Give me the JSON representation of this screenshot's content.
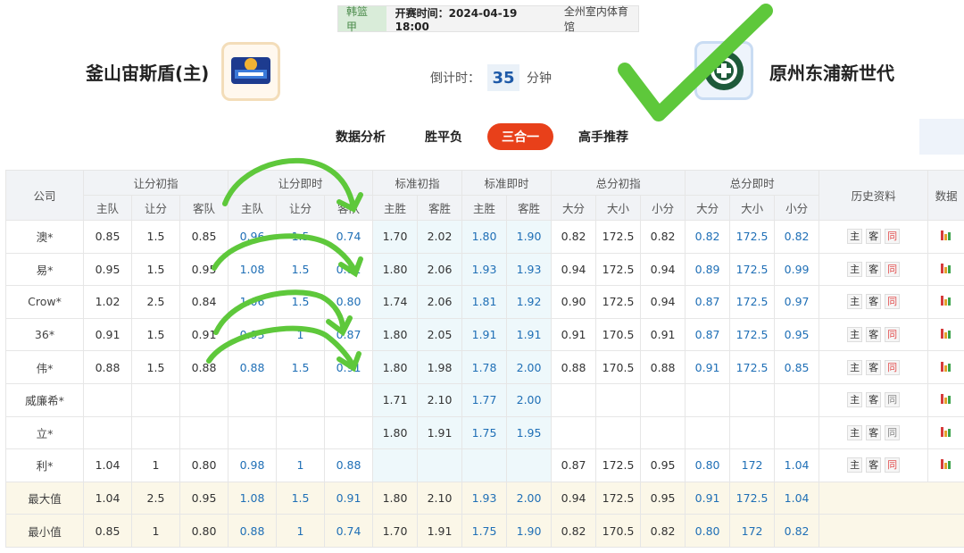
{
  "header": {
    "league": "韩篮甲",
    "start_time": "开赛时间：2024-04-19 18:00",
    "venue": "全州室内体育馆",
    "home_team": "釜山宙斯盾(主)",
    "away_team": "原州东浦新世代",
    "countdown_label": "倒计时：",
    "countdown_value": "35",
    "countdown_unit": "分钟"
  },
  "tabs": [
    "数据分析",
    "胜平负",
    "三合一",
    "高手推荐"
  ],
  "active_tab": "三合一",
  "table": {
    "group_headers": [
      "公司",
      "让分初指",
      "让分即时",
      "标准初指",
      "标准即时",
      "总分初指",
      "总分即时",
      "历史资料",
      "数据"
    ],
    "sub_headers": [
      "主队",
      "让分",
      "客队",
      "主队",
      "让分",
      "客队",
      "主胜",
      "客胜",
      "主胜",
      "客胜",
      "大分",
      "大小",
      "小分",
      "大分",
      "大小",
      "小分"
    ],
    "history_buttons": [
      "主",
      "客",
      "同"
    ],
    "rows": [
      {
        "company": "澳*",
        "h_init": [
          "0.85",
          "1.5",
          "0.85"
        ],
        "h_live": [
          "0.96",
          "1.5",
          "0.74"
        ],
        "s_init": [
          "1.70",
          "2.02"
        ],
        "s_live": [
          "1.80",
          "1.90"
        ],
        "t_init": [
          "0.82",
          "172.5",
          "0.82"
        ],
        "t_live": [
          "0.82",
          "172.5",
          "0.82"
        ],
        "same_red": true
      },
      {
        "company": "易*",
        "h_init": [
          "0.95",
          "1.5",
          "0.95"
        ],
        "h_live": [
          "1.08",
          "1.5",
          "0.82"
        ],
        "s_init": [
          "1.80",
          "2.06"
        ],
        "s_live": [
          "1.93",
          "1.93"
        ],
        "t_init": [
          "0.94",
          "172.5",
          "0.94"
        ],
        "t_live": [
          "0.89",
          "172.5",
          "0.99"
        ],
        "same_red": true
      },
      {
        "company": "Crow*",
        "h_init": [
          "1.02",
          "2.5",
          "0.84"
        ],
        "h_live": [
          "1.06",
          "1.5",
          "0.80"
        ],
        "s_init": [
          "1.74",
          "2.06"
        ],
        "s_live": [
          "1.81",
          "1.92"
        ],
        "t_init": [
          "0.90",
          "172.5",
          "0.94"
        ],
        "t_live": [
          "0.87",
          "172.5",
          "0.97"
        ],
        "same_red": true
      },
      {
        "company": "36*",
        "h_init": [
          "0.91",
          "1.5",
          "0.91"
        ],
        "h_live": [
          "0.93",
          "1",
          "0.87"
        ],
        "s_init": [
          "1.80",
          "2.05"
        ],
        "s_live": [
          "1.91",
          "1.91"
        ],
        "t_init": [
          "0.91",
          "170.5",
          "0.91"
        ],
        "t_live": [
          "0.87",
          "172.5",
          "0.95"
        ],
        "same_red": true
      },
      {
        "company": "伟*",
        "h_init": [
          "0.88",
          "1.5",
          "0.88"
        ],
        "h_live": [
          "0.88",
          "1.5",
          "0.91"
        ],
        "s_init": [
          "1.80",
          "1.98"
        ],
        "s_live": [
          "1.78",
          "2.00"
        ],
        "t_init": [
          "0.88",
          "170.5",
          "0.88"
        ],
        "t_live": [
          "0.91",
          "172.5",
          "0.85"
        ],
        "same_red": true
      },
      {
        "company": "威廉希*",
        "h_init": [
          "",
          "",
          ""
        ],
        "h_live": [
          "",
          "",
          ""
        ],
        "s_init": [
          "1.71",
          "2.10"
        ],
        "s_live": [
          "1.77",
          "2.00"
        ],
        "t_init": [
          "",
          "",
          ""
        ],
        "t_live": [
          "",
          "",
          ""
        ],
        "same_red": false
      },
      {
        "company": "立*",
        "h_init": [
          "",
          "",
          ""
        ],
        "h_live": [
          "",
          "",
          ""
        ],
        "s_init": [
          "1.80",
          "1.91"
        ],
        "s_live": [
          "1.75",
          "1.95"
        ],
        "t_init": [
          "",
          "",
          ""
        ],
        "t_live": [
          "",
          "",
          ""
        ],
        "same_red": false
      },
      {
        "company": "利*",
        "h_init": [
          "1.04",
          "1",
          "0.80"
        ],
        "h_live": [
          "0.98",
          "1",
          "0.88"
        ],
        "s_init": [
          "",
          ""
        ],
        "s_live": [
          "",
          ""
        ],
        "t_init": [
          "0.87",
          "172.5",
          "0.95"
        ],
        "t_live": [
          "0.80",
          "172",
          "1.04"
        ],
        "same_red": true
      }
    ],
    "summary": [
      {
        "label": "最大值",
        "h_init": [
          "1.04",
          "2.5",
          "0.95"
        ],
        "h_live": [
          "1.08",
          "1.5",
          "0.91"
        ],
        "s_init": [
          "1.80",
          "2.10"
        ],
        "s_live": [
          "1.93",
          "2.00"
        ],
        "t_init": [
          "0.94",
          "172.5",
          "0.95"
        ],
        "t_live": [
          "0.91",
          "172.5",
          "1.04"
        ]
      },
      {
        "label": "最小值",
        "h_init": [
          "0.85",
          "1",
          "0.80"
        ],
        "h_live": [
          "0.88",
          "1",
          "0.74"
        ],
        "s_init": [
          "1.70",
          "1.91"
        ],
        "s_live": [
          "1.75",
          "1.90"
        ],
        "t_init": [
          "0.82",
          "170.5",
          "0.82"
        ],
        "t_live": [
          "0.80",
          "172",
          "0.82"
        ]
      }
    ]
  },
  "colors": {
    "accent": "#e8401a",
    "live_value": "#1f6fb6",
    "annotation_green": "#5ec83b",
    "same_red": "#e25050"
  }
}
